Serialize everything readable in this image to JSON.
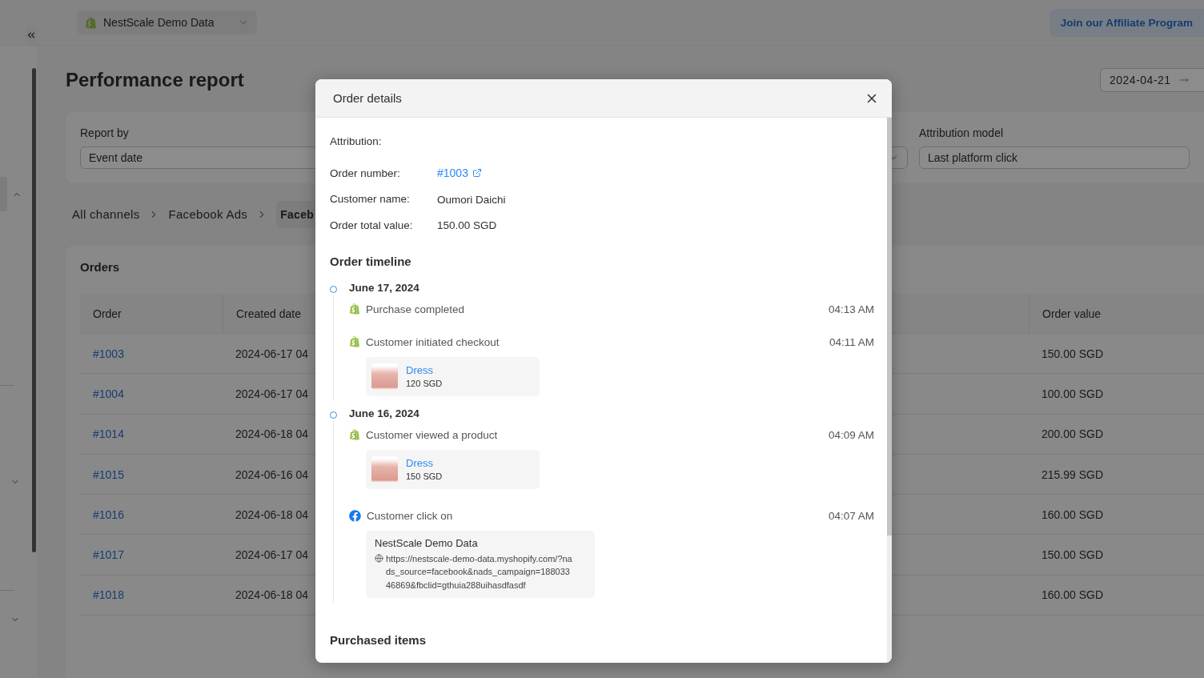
{
  "top_bar": {
    "store_selector": "NestScale Demo Data",
    "affiliate_button": "Join our Affiliate Program"
  },
  "page": {
    "title": "Performance report",
    "date_start": "2024-04-21"
  },
  "filters": [
    {
      "label": "Report by",
      "value": "Event date"
    },
    {
      "label": "Attribution model",
      "value": "Last platform click"
    }
  ],
  "breadcrumb": [
    {
      "label": "All channels",
      "selected": false
    },
    {
      "label": "Facebook Ads",
      "selected": false
    },
    {
      "label": "Faceb",
      "selected": true
    }
  ],
  "orders": {
    "title": "Orders",
    "columns": [
      "Order",
      "Created date",
      "Order value"
    ],
    "rows": [
      {
        "order": "#1003",
        "created": "2024-06-17 04",
        "value": "150.00 SGD"
      },
      {
        "order": "#1004",
        "created": "2024-06-17 04",
        "value": "100.00 SGD"
      },
      {
        "order": "#1014",
        "created": "2024-06-18 04",
        "value": "200.00 SGD"
      },
      {
        "order": "#1015",
        "created": "2024-06-16 04",
        "value": "215.99 SGD"
      },
      {
        "order": "#1016",
        "created": "2024-06-18 04",
        "value": "160.00 SGD"
      },
      {
        "order": "#1017",
        "created": "2024-06-17 04",
        "value": "150.00 SGD"
      },
      {
        "order": "#1018",
        "created": "2024-06-18 04",
        "value": "160.00 SGD"
      }
    ]
  },
  "modal": {
    "title": "Order details",
    "attribution_label": "Attribution:",
    "fields": [
      {
        "kind": "link",
        "label": "Order number:",
        "value": "#1003"
      },
      {
        "kind": "text",
        "label": "Customer name:",
        "value": "Oumori Daichi"
      },
      {
        "kind": "text",
        "label": "Order total value:",
        "value": "150.00 SGD"
      }
    ],
    "timeline_title": "Order timeline",
    "timeline": [
      {
        "date": "June 17, 2024",
        "events": [
          {
            "kind": "shopify",
            "text": "Purchase completed",
            "time": "04:13 AM"
          },
          {
            "kind": "shopify",
            "text": "Customer initiated checkout",
            "time": "04:11 AM",
            "attachment": {
              "kind": "product",
              "name": "Dress",
              "price": "120 SGD"
            }
          }
        ]
      },
      {
        "date": "June 16, 2024",
        "events": [
          {
            "kind": "shopify",
            "text": "Customer viewed a product",
            "time": "04:09 AM",
            "attachment": {
              "kind": "product",
              "name": "Dress",
              "price": "150 SGD"
            }
          },
          {
            "kind": "facebook",
            "text": "Customer click on",
            "time": "04:07 AM",
            "attachment": {
              "kind": "link",
              "title": "NestScale Demo Data",
              "url": "https://nestscale-demo-data.myshopify.com/?nads_source=facebook&nads_campaign=18803346869&fbclid=gthuia288uihasdfasdf"
            }
          }
        ]
      }
    ],
    "purchased_title": "Purchased items"
  }
}
